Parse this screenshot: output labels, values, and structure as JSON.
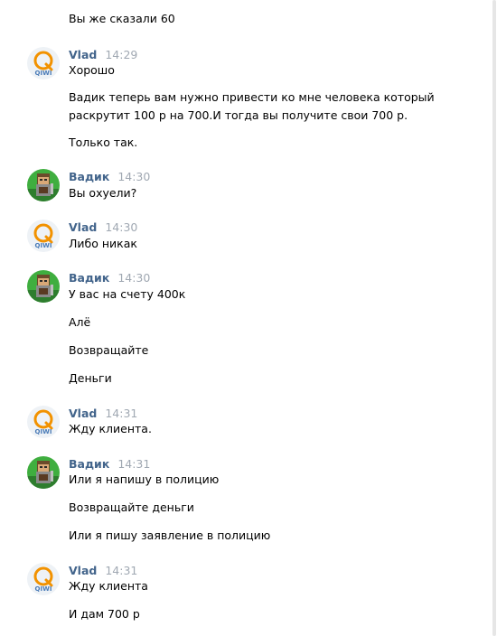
{
  "colors": {
    "author": "#42648b",
    "time": "#a0a8b2",
    "qiwi_orange": "#f29200",
    "qiwi_blue": "#4a7bb7"
  },
  "messages": [
    {
      "lines": [
        "Вы же сказали 60"
      ]
    },
    {
      "author": "Vlad",
      "time": "14:29",
      "avatar": "qiwi-logo",
      "lines": [
        "Хорошо",
        "Вадик теперь вам нужно привести ко мне человека который",
        "раскрутит 100 р на 700.И тогда вы получите свои 700 р.",
        "Только так."
      ]
    },
    {
      "author": "Вадик",
      "time": "14:30",
      "avatar": "minecraft-character",
      "lines": [
        "Вы охуели?"
      ]
    },
    {
      "author": "Vlad",
      "time": "14:30",
      "avatar": "qiwi-logo",
      "lines": [
        "Либо никак"
      ]
    },
    {
      "author": "Вадик",
      "time": "14:30",
      "avatar": "minecraft-character",
      "lines": [
        "У вас на счету 400к",
        "Алё",
        "Возвращайте",
        "Деньги"
      ]
    },
    {
      "author": "Vlad",
      "time": "14:31",
      "avatar": "qiwi-logo",
      "lines": [
        "Жду клиента."
      ]
    },
    {
      "author": "Вадик",
      "time": "14:31",
      "avatar": "minecraft-character",
      "lines": [
        "Или я напишу в полицию",
        "Возвращайте деньги",
        "Или я пишу заявление в полицию"
      ]
    },
    {
      "author": "Vlad",
      "time": "14:31",
      "avatar": "qiwi-logo",
      "lines": [
        "Жду клиента",
        "И дам 700 р"
      ]
    }
  ],
  "qiwi_logo_text": "QIWI"
}
